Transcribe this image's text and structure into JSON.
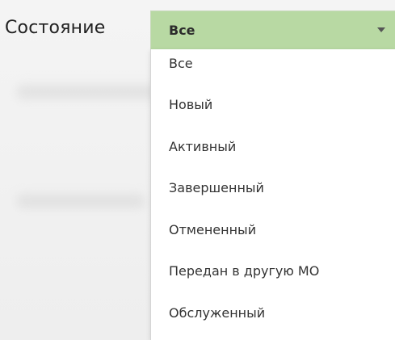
{
  "filter": {
    "label": "Состояние",
    "selected_value": "Все",
    "arrow_icon": "chevron-down-icon",
    "selected_bg_color": "#b8d9a3"
  },
  "dropdown": {
    "options": [
      {
        "label": "Все"
      },
      {
        "label": "Новый"
      },
      {
        "label": "Активный"
      },
      {
        "label": "Завершенный"
      },
      {
        "label": "Отмененный"
      },
      {
        "label": "Передан в другую МО"
      },
      {
        "label": "Обслуженный"
      }
    ]
  }
}
